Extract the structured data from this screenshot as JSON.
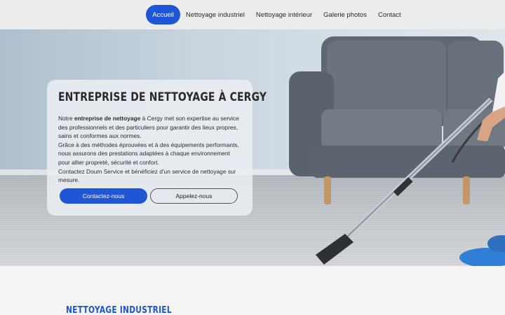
{
  "nav": {
    "items": [
      {
        "label": "Accueil",
        "active": true
      },
      {
        "label": "Nettoyage industriel",
        "active": false
      },
      {
        "label": "Nettoyage intérieur",
        "active": false
      },
      {
        "label": "Galerie photos",
        "active": false
      },
      {
        "label": "Contact",
        "active": false
      }
    ]
  },
  "hero": {
    "title": "ENTREPRISE DE NETTOYAGE À CERGY",
    "p1_pre": "Notre ",
    "p1_bold": "entreprise de nettoyage",
    "p1_post": " à Cergy met son expertise au service des professionnels et des particuliers pour garantir des lieux propres, sains et conformes aux normes.",
    "p2": "Grâce à des méthodes éprouvées et à des équipements performants, nous assurons des prestations adaptées à chaque environnement pour allier propreté, sécurité et confort.",
    "p3": "Contactez Doum Service et bénéficiez d'un service de nettoyage sur mesure.",
    "primary_button": "Contactez-nous",
    "secondary_button": "Appelez-nous"
  },
  "section": {
    "title": "NETTOYAGE INDUSTRIEL"
  },
  "colors": {
    "accent": "#1f56d8",
    "nav_bg": "#ececec"
  }
}
